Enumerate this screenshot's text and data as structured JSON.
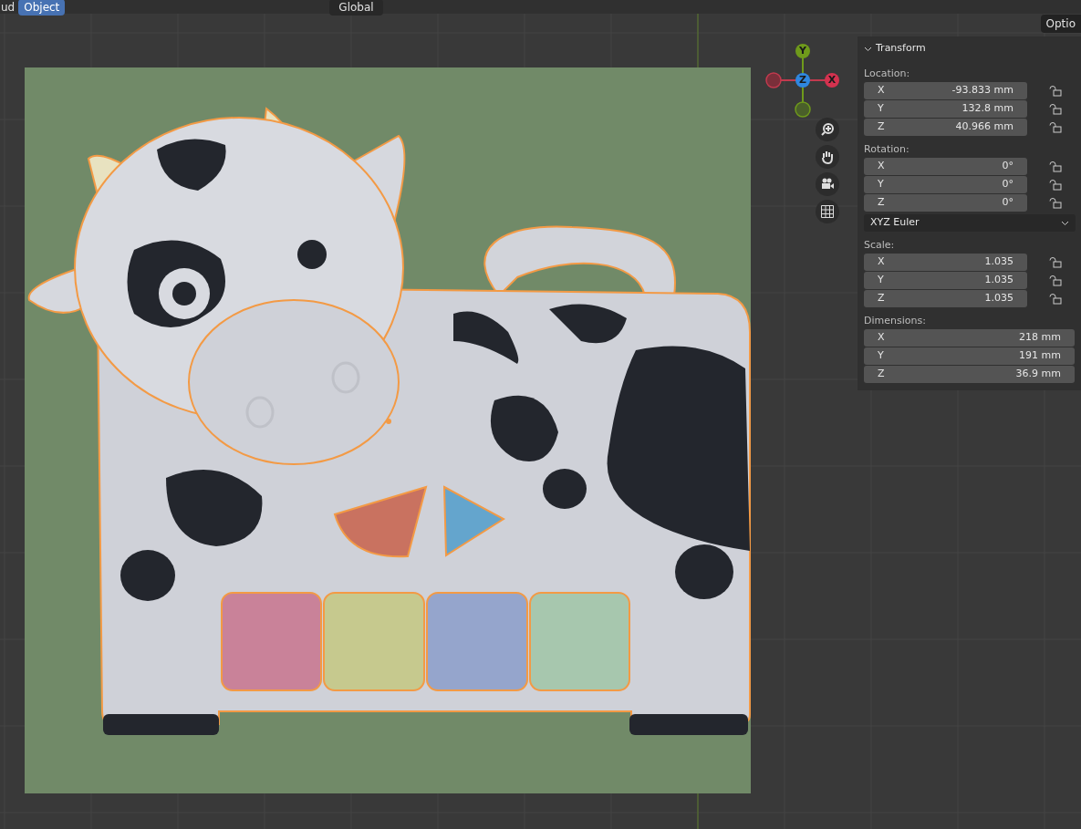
{
  "header": {
    "mode_partial": "ud",
    "mode": "Object",
    "orientation": "Global"
  },
  "options_button": "Optio",
  "gizmo": {
    "axes": [
      {
        "kind": "y",
        "label": "Y"
      },
      {
        "kind": "z",
        "label": "Z"
      },
      {
        "kind": "x",
        "label": "X"
      }
    ]
  },
  "sidebar": {
    "title": "Transform",
    "expanded": true,
    "sections": [
      {
        "label": "Location:",
        "fields": [
          {
            "axis": "X",
            "value": "-93.833 mm",
            "locked": false
          },
          {
            "axis": "Y",
            "value": "132.8 mm",
            "locked": false
          },
          {
            "axis": "Z",
            "value": "40.966 mm",
            "locked": false
          }
        ]
      },
      {
        "label": "Rotation:",
        "fields": [
          {
            "axis": "X",
            "value": "0°",
            "locked": false
          },
          {
            "axis": "Y",
            "value": "0°",
            "locked": false
          },
          {
            "axis": "Z",
            "value": "0°",
            "locked": false
          }
        ],
        "mode": "XYZ Euler"
      },
      {
        "label": "Scale:",
        "fields": [
          {
            "axis": "X",
            "value": "1.035",
            "locked": false
          },
          {
            "axis": "Y",
            "value": "1.035",
            "locked": false
          },
          {
            "axis": "Z",
            "value": "1.035",
            "locked": false
          }
        ]
      },
      {
        "label": "Dimensions:",
        "fields": [
          {
            "axis": "X",
            "value": "218 mm"
          },
          {
            "axis": "Y",
            "value": "191 mm"
          },
          {
            "axis": "Z",
            "value": "36.9 mm"
          }
        ]
      }
    ]
  }
}
